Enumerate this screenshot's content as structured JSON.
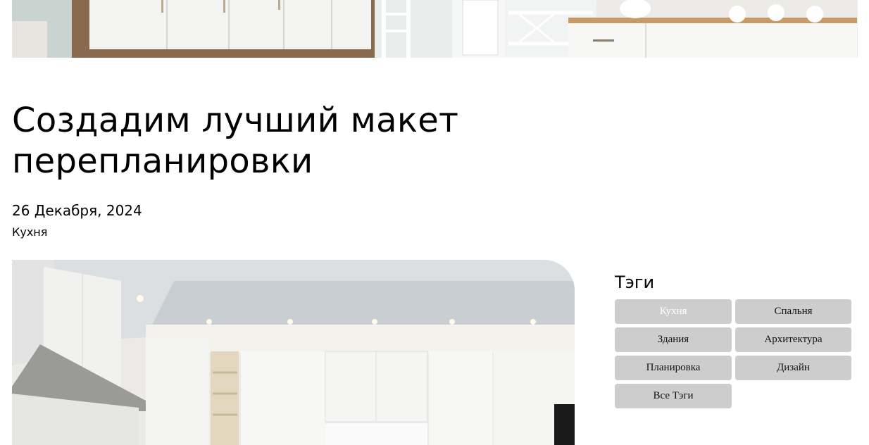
{
  "article": {
    "title": "Создадим лучший макет перепланировки",
    "date": "26 Декабря, 2024",
    "category": "Кухня"
  },
  "sidebar": {
    "tags_title": "Тэги",
    "tags": [
      {
        "label": "Кухня",
        "active": true
      },
      {
        "label": "Спальня",
        "active": false
      },
      {
        "label": "Здания",
        "active": false
      },
      {
        "label": "Архитектура",
        "active": false
      },
      {
        "label": "Планировка",
        "active": false
      },
      {
        "label": "Дизайн",
        "active": false
      },
      {
        "label": "Все Тэги",
        "active": false
      }
    ]
  },
  "colors": {
    "tag_bg": "#cdcdcd",
    "tag_active_text": "#ffffff",
    "text": "#000000"
  }
}
